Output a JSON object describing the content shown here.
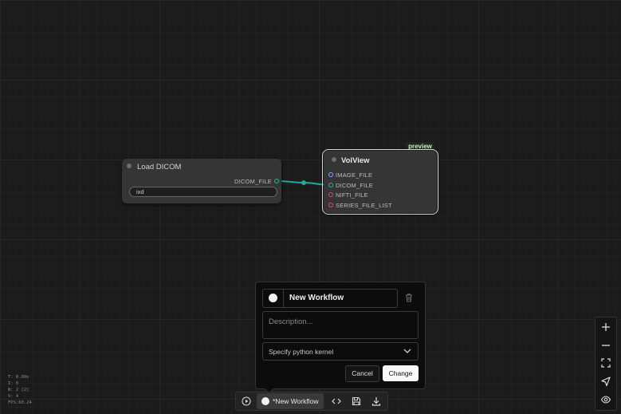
{
  "nodes": {
    "load_dicom": {
      "title": "Load DICOM",
      "output_label": "DICOM_FILE",
      "widget_value": "ixd"
    },
    "volview": {
      "title": "VolView",
      "badge": "preview",
      "inputs": [
        {
          "label": "IMAGE_FILE",
          "color": "#7fa6ff"
        },
        {
          "label": "DICOM_FILE",
          "color": "#2bb5a5"
        },
        {
          "label": "NIFTI_FILE",
          "color": "#e0457b"
        },
        {
          "label": "SERIES_FILE_LIST",
          "color": "#e0457b"
        }
      ]
    }
  },
  "link_color": "#22a89a",
  "dialog": {
    "name_value": "New Workflow",
    "description_placeholder": "Description...",
    "kernel_select": "Specify python kernel",
    "cancel_label": "Cancel",
    "change_label": "Change"
  },
  "toolbar": {
    "workflow_label": "*New Workflow",
    "icons": [
      "play-icon",
      "code-icon",
      "save-icon",
      "download-icon"
    ]
  },
  "zoom_controls": {
    "icons": [
      "zoom-in-icon",
      "zoom-out-icon",
      "fit-view-icon",
      "navigate-icon",
      "eye-icon"
    ]
  },
  "stats": {
    "lines": [
      "T: 0.00s",
      "I: 0",
      "N: 2 [2]",
      "V: 4",
      "FPS:60.24"
    ]
  }
}
